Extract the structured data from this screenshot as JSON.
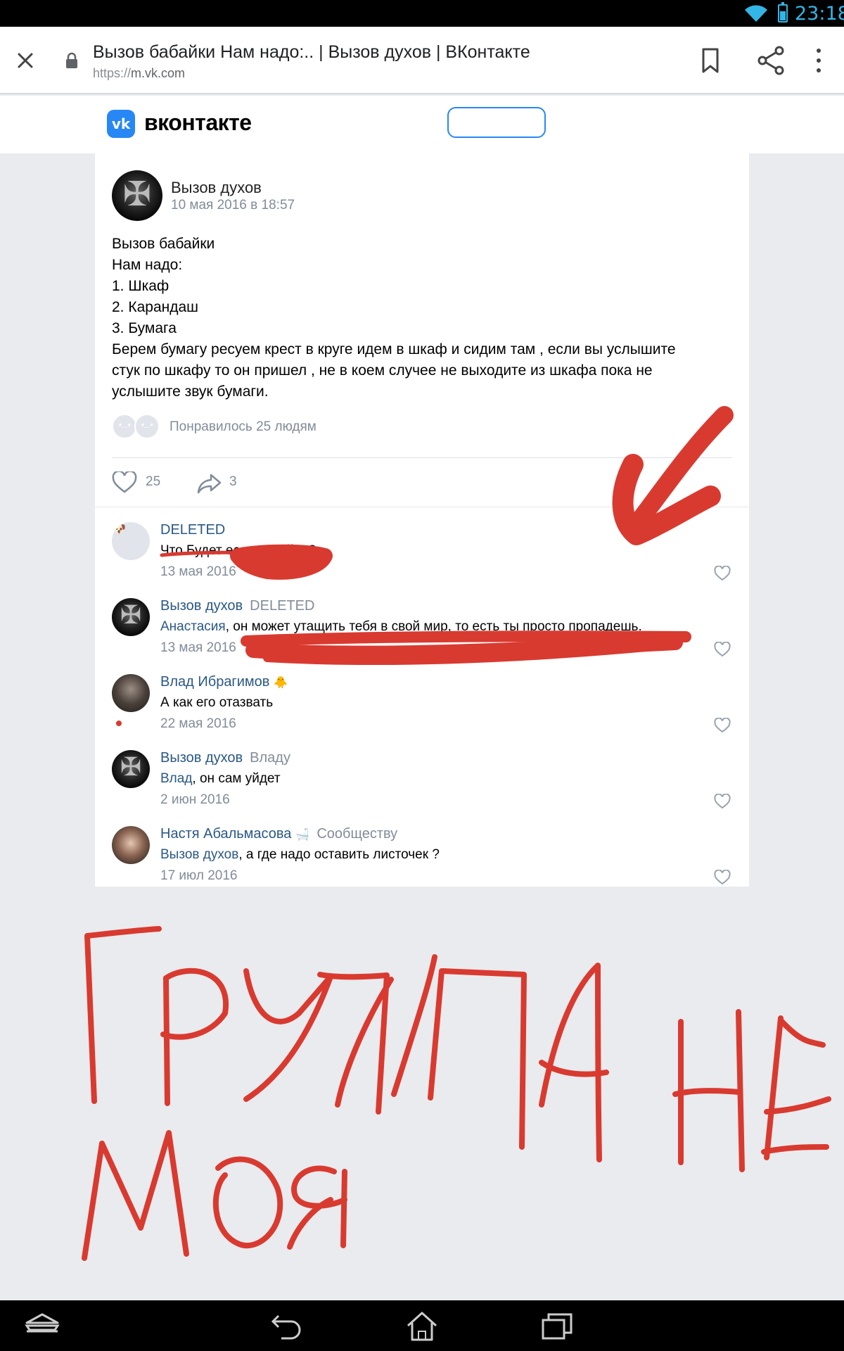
{
  "status_bar": {
    "time": "23:18"
  },
  "browser": {
    "page_title": "Вызов бабайки Нам надо:.. | Вызов духов | ВКонтакте",
    "url_protocol": "https://",
    "url_host": "m.vk.com",
    "icons": [
      "close-icon",
      "lock-icon",
      "bookmark-icon",
      "share-icon",
      "more-vert-icon"
    ]
  },
  "vk_header": {
    "logo_text": "vk",
    "wordmark": "вконтакте"
  },
  "post": {
    "author": "Вызов духов",
    "date": "10 мая 2016 в 18:57",
    "lines": [
      "Вызов бабайки",
      "Нам надо:",
      "1. Шкаф",
      "2. Карандаш",
      "3. Бумага",
      "Берем бумагу ресуем крест в круге идем в шкаф и сидим там , если вы услышите",
      "стук по шкафу то он пришел , не в коем случее не выходите из шкафа пока не",
      "услышите звук бумаги."
    ],
    "liked_by_text": "Понравилось 25 людям",
    "like_count": "25",
    "share_count": "3"
  },
  "comments": [
    {
      "author": "DELETED",
      "reply_to": "",
      "emoji": "",
      "mention": "",
      "text": "Что Будет если я выйду?",
      "date": "13 мая 2016"
    },
    {
      "author": "Вызов духов",
      "reply_to": "DELETED",
      "emoji": "",
      "mention": "Анастасия",
      "text": ", он может утащить тебя в свой мир, то есть ты просто пропадешь.",
      "date": "13 мая 2016"
    },
    {
      "author": "Влад Ибрагимов",
      "reply_to": "",
      "emoji": "🐥",
      "mention": "",
      "text": "А как его отазвать",
      "date": "22 мая 2016"
    },
    {
      "author": "Вызов духов",
      "reply_to": "Владу",
      "emoji": "",
      "mention": "Влад",
      "text": ", он сам уйдет",
      "date": "2 июн 2016"
    },
    {
      "author": "Настя Абальмасова",
      "reply_to": "Сообществу",
      "emoji": "🛁",
      "mention": "Вызов духов",
      "text": ", а где надо оставить листочек ?",
      "date": "17 июл 2016"
    }
  ],
  "handwriting": {
    "text": "ГРУППА НЕ Моя",
    "color": "#d93a30"
  },
  "colors": {
    "link": "#2a5885",
    "meta": "#818c99",
    "vk_blue": "#2787f5",
    "status_accent": "#33b5e5"
  }
}
